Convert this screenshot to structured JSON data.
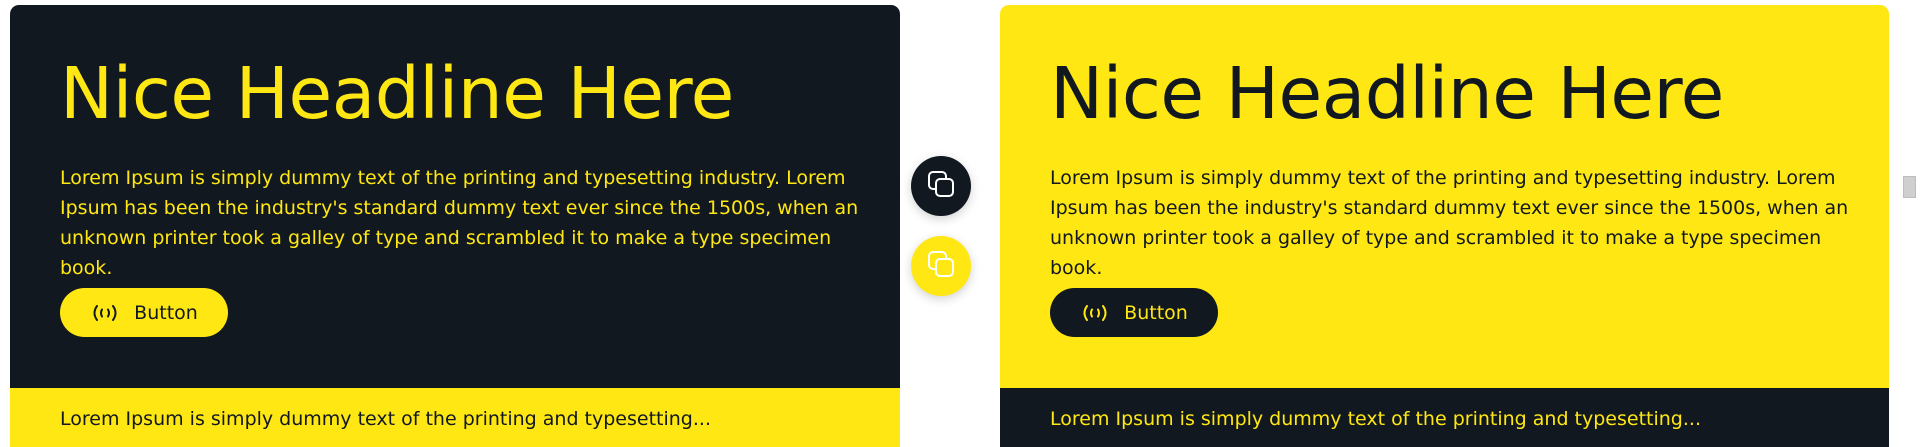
{
  "colors": {
    "dark": "#111820",
    "accent": "#ffe713",
    "background": "#ffffff"
  },
  "cards": [
    {
      "theme": "dark",
      "headline": "Nice Headline Here",
      "paragraph": "Lorem Ipsum is simply dummy text of the printing and typesetting industry. Lorem Ipsum has been the industry's standard dummy text ever since the 1500s, when an unknown printer took a galley of type and scrambled it to make a type specimen book.",
      "button_label": "Button",
      "button_icon": "broadcast-icon",
      "footer_text": "Lorem Ipsum is simply dummy text of the printing and typesetting..."
    },
    {
      "theme": "light",
      "headline": "Nice Headline Here",
      "paragraph": "Lorem Ipsum is simply dummy text of the printing and typesetting industry. Lorem Ipsum has been the industry's standard dummy text ever since the 1500s, when an unknown printer took a galley of type and scrambled it to make a type specimen book.",
      "button_label": "Button",
      "button_icon": "broadcast-icon",
      "footer_text": "Lorem Ipsum is simply dummy text of the printing and typesetting..."
    }
  ],
  "copy_buttons": [
    {
      "icon": "copy-icon",
      "theme": "dark"
    },
    {
      "icon": "copy-icon",
      "theme": "light"
    }
  ]
}
